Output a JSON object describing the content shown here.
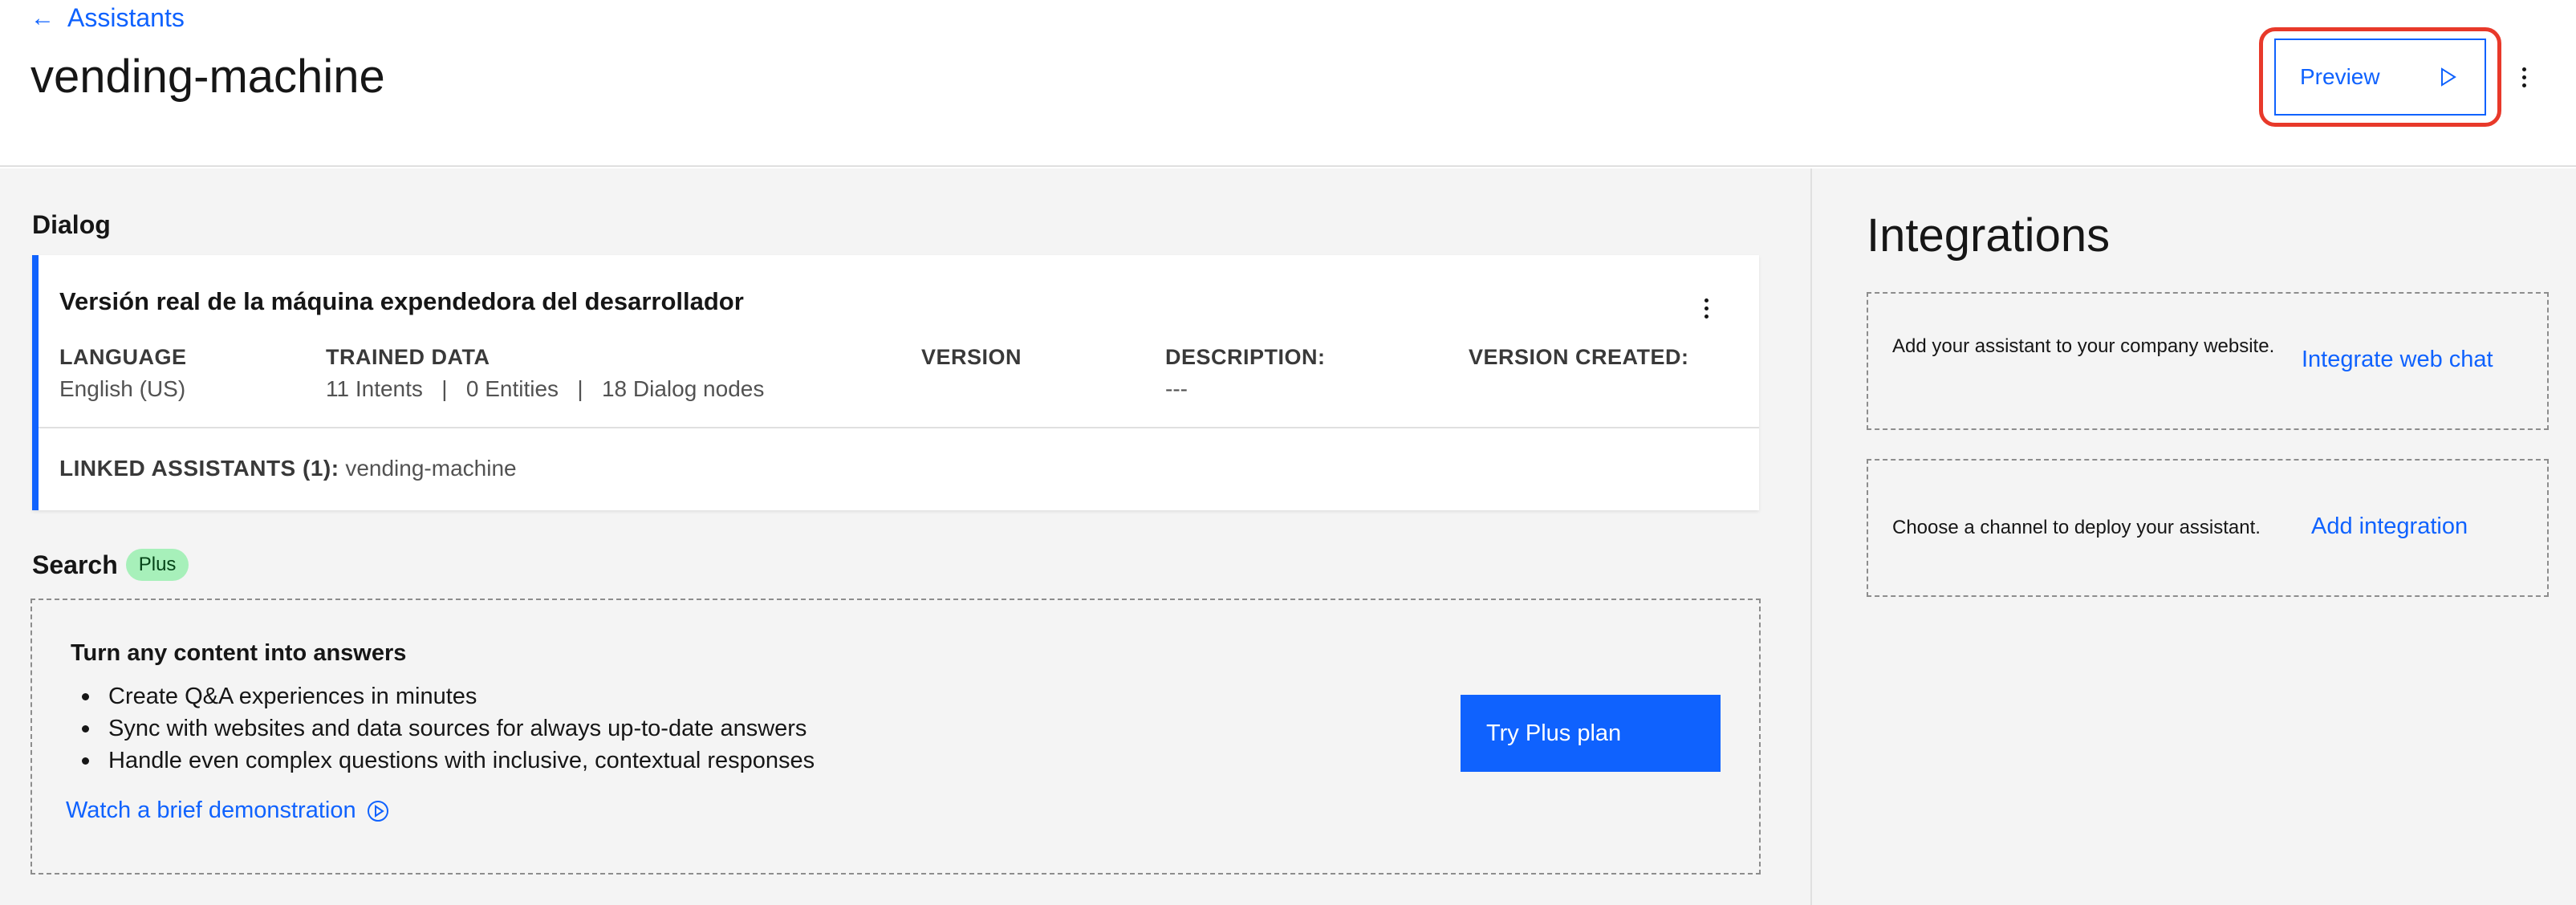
{
  "header": {
    "back_label": "Assistants",
    "title": "vending-machine",
    "preview_label": "Preview"
  },
  "dialog": {
    "section_title": "Dialog",
    "name": "Versión real de la máquina expendedora del desarrollador",
    "columns": [
      {
        "label": "LANGUAGE",
        "value": "English (US)"
      },
      {
        "label": "TRAINED DATA",
        "value": "11 Intents   |   0 Entities   |   18 Dialog nodes"
      },
      {
        "label": "VERSION",
        "value": ""
      },
      {
        "label": "DESCRIPTION:",
        "value": "---"
      },
      {
        "label": "VERSION CREATED:",
        "value": ""
      }
    ],
    "linked_label": "LINKED ASSISTANTS (1):",
    "linked_value": "vending-machine"
  },
  "search": {
    "section_title": "Search",
    "badge": "Plus",
    "headline": "Turn any content into answers",
    "bullets": [
      "Create Q&A experiences in minutes",
      "Sync with websites and data sources for always up-to-date answers",
      "Handle even complex questions with inclusive, contextual responses"
    ],
    "demo_link": "Watch a brief demonstration",
    "cta": "Try Plus plan"
  },
  "integrations": {
    "title": "Integrations",
    "items": [
      {
        "text": "Add your assistant to your company website.",
        "link": "Integrate web chat"
      },
      {
        "text": "Choose a channel to deploy your assistant.",
        "link": "Add integration"
      }
    ]
  },
  "colors": {
    "accent": "#0f62fe",
    "highlight": "#e8392a",
    "badge_bg": "#a7f0ba",
    "panel_bg": "#f4f4f4"
  },
  "icons": [
    "arrow-left-icon",
    "play-icon",
    "overflow-menu-icon",
    "play-circle-icon"
  ]
}
